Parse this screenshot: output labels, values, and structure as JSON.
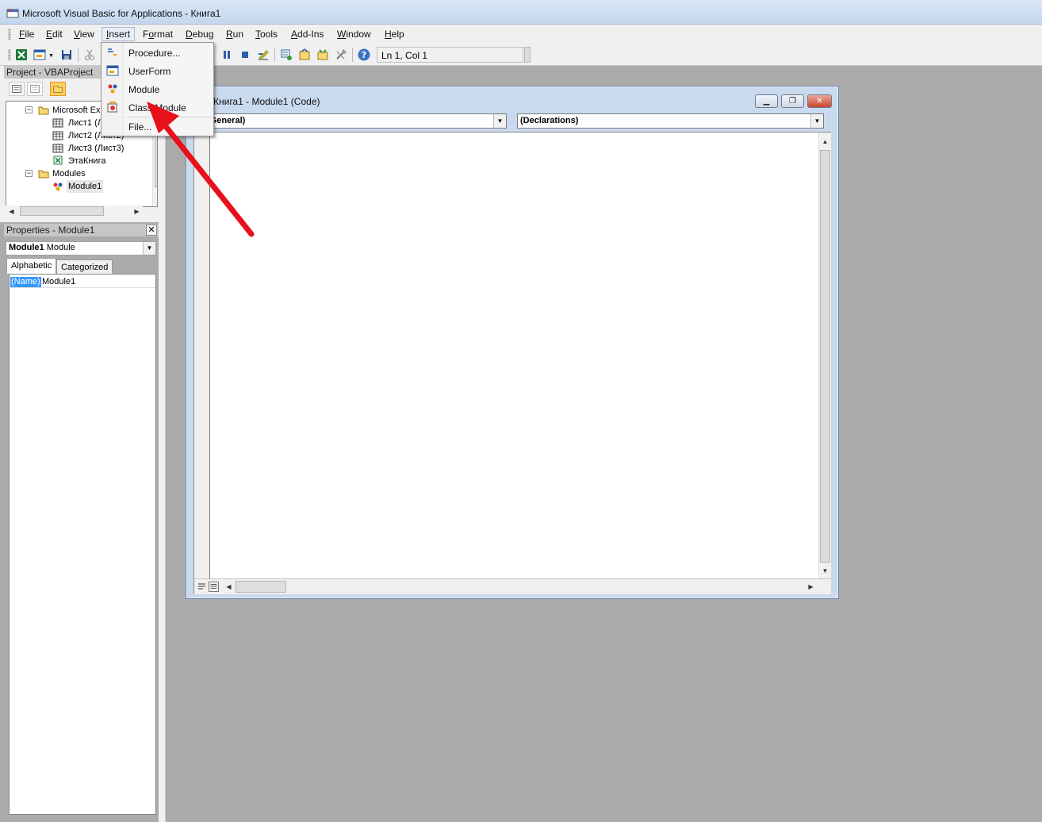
{
  "window": {
    "title": "Microsoft Visual Basic for Applications - Книга1"
  },
  "menubar": {
    "items": [
      {
        "label": "File",
        "accent": "F"
      },
      {
        "label": "Edit",
        "accent": "E"
      },
      {
        "label": "View",
        "accent": "V"
      },
      {
        "label": "Insert",
        "accent": "I",
        "active": true
      },
      {
        "label": "Format",
        "accent": "o"
      },
      {
        "label": "Debug",
        "accent": "D"
      },
      {
        "label": "Run",
        "accent": "R"
      },
      {
        "label": "Tools",
        "accent": "T"
      },
      {
        "label": "Add-Ins",
        "accent": "A"
      },
      {
        "label": "Window",
        "accent": "W"
      },
      {
        "label": "Help",
        "accent": "H"
      }
    ]
  },
  "insert_menu": {
    "items": [
      {
        "label": "Procedure...",
        "icon": "procedure-icon"
      },
      {
        "label": "UserForm",
        "icon": "userform-icon"
      },
      {
        "label": "Module",
        "icon": "module-icon"
      },
      {
        "label": "Class Module",
        "icon": "class-module-icon"
      },
      {
        "label": "File...",
        "icon": ""
      }
    ]
  },
  "toolbar": {
    "position": "Ln 1, Col 1",
    "icons": [
      "excel-icon",
      "insert-userform-icon",
      "dropdown-arrow-icon",
      "save-icon",
      "cut-icon",
      "break-icon",
      "reset-icon",
      "design-mode-icon",
      "project-explorer-icon",
      "properties-icon",
      "object-browser-icon",
      "toolbox-icon",
      "help-icon"
    ]
  },
  "project": {
    "header": "Project - VBAProject",
    "tree": [
      {
        "label": "Microsoft Exc",
        "level": 1,
        "icon": "folder-icon",
        "toggle": "-"
      },
      {
        "label": "Лист1 (Лист1)",
        "level": 2,
        "icon": "sheet-icon"
      },
      {
        "label": "Лист2 (Лист2)",
        "level": 2,
        "icon": "sheet-icon"
      },
      {
        "label": "Лист3 (Лист3)",
        "level": 2,
        "icon": "sheet-icon"
      },
      {
        "label": "ЭтаКнига",
        "level": 2,
        "icon": "workbook-icon"
      },
      {
        "label": "Modules",
        "level": 1,
        "icon": "folder-icon",
        "toggle": "-"
      },
      {
        "label": "Module1",
        "level": 2,
        "icon": "module-icon",
        "selected": true
      }
    ]
  },
  "properties": {
    "header": "Properties - Module1",
    "object_name": "Module1",
    "object_type": "Module",
    "tabs": [
      "Alphabetic",
      "Categorized"
    ],
    "rows": [
      {
        "name": "(Name)",
        "value": "Module1"
      }
    ]
  },
  "code_window": {
    "title": "Книга1 - Module1 (Code)",
    "object_combo": "(General)",
    "procedure_combo": "(Declarations)"
  },
  "colors": {
    "workspace": "#ababab",
    "titlebar": "#c3d6ee",
    "selection": "#3399ff",
    "arrow": "#e8101a"
  }
}
